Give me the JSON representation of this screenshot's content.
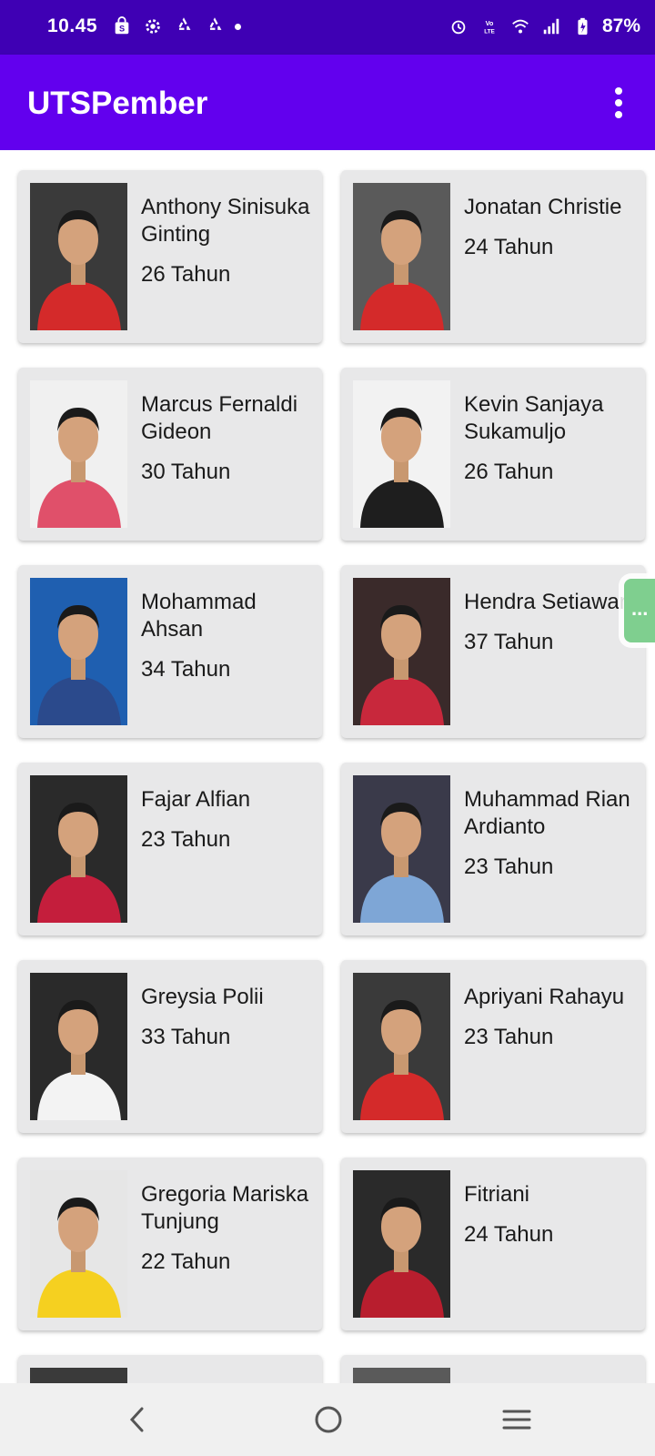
{
  "status_bar": {
    "time": "10.45",
    "battery": "87%",
    "left_icons": [
      "shop-icon",
      "settings-icon",
      "recycle-icon",
      "recycle-icon",
      "dot-icon"
    ],
    "right_icons": [
      "alarm-icon",
      "volte-icon",
      "wifi-icon",
      "signal-icon",
      "battery-icon"
    ]
  },
  "app_bar": {
    "title": "UTSPember",
    "menu_icon": "more-vert-icon"
  },
  "colors": {
    "status_bar": "#3f00b4",
    "app_bar": "#6200ee",
    "card": "#e8e8e9",
    "floating_bubble": "#7fcf8f"
  },
  "athletes": [
    {
      "name": "Anthony Sinisuka\nGinting",
      "age": "26 Tahun"
    },
    {
      "name": "Jonatan Christie",
      "age": "24 Tahun"
    },
    {
      "name": "Marcus Fernaldi\nGideon",
      "age": "30 Tahun"
    },
    {
      "name": "Kevin Sanjaya\nSukamuljo",
      "age": "26 Tahun"
    },
    {
      "name": "Mohammad\nAhsan",
      "age": "34 Tahun"
    },
    {
      "name": "Hendra Setiawan",
      "age": "37 Tahun"
    },
    {
      "name": "Fajar Alfian",
      "age": "23 Tahun"
    },
    {
      "name": "Muhammad Rian\nArdianto",
      "age": "23 Tahun"
    },
    {
      "name": "Greysia Polii",
      "age": "33 Tahun"
    },
    {
      "name": "Apriyani Rahayu",
      "age": "23 Tahun"
    },
    {
      "name": "Gregoria Mariska\nTunjung",
      "age": "22 Tahun"
    },
    {
      "name": "Fitriani",
      "age": "24 Tahun"
    }
  ],
  "floating_bubble": {
    "label": "..."
  },
  "nav_bar": {
    "back_icon": "back-icon",
    "home_icon": "home-icon",
    "recents_icon": "recents-icon"
  }
}
